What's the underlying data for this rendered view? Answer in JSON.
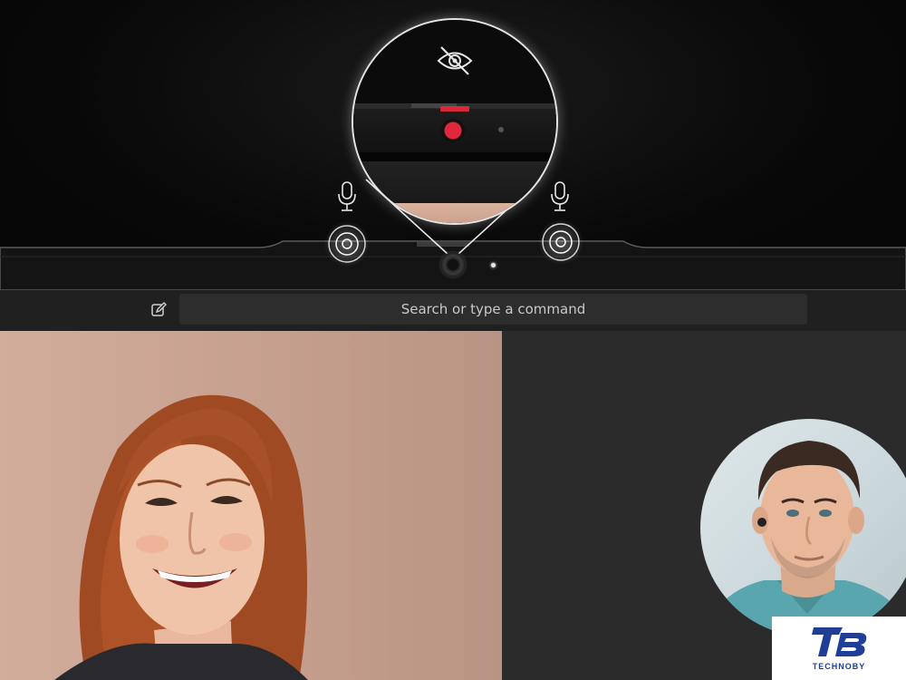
{
  "search": {
    "placeholder": "Search or type a command"
  },
  "icons": {
    "compose": "compose-icon",
    "privacy": "eye-slash-icon",
    "microphone": "microphone-icon"
  },
  "colors": {
    "privacy_shutter": "#d9263a",
    "toolbar_bg": "#202020",
    "search_bg": "#2d2d2d",
    "tile_bg": "#2b2b2b"
  },
  "watermark": {
    "text": "TECHNOBY",
    "logo": "TB"
  }
}
